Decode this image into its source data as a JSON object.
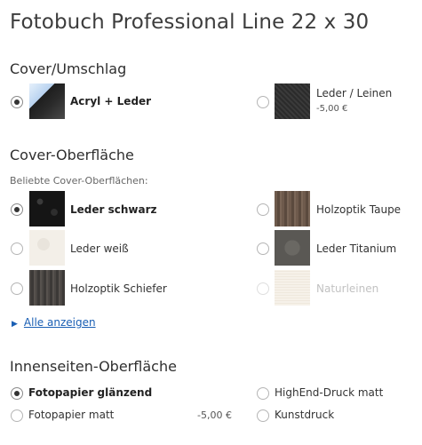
{
  "title": "Fotobuch Professional Line 22 x 30",
  "cover": {
    "heading": "Cover/Umschlag",
    "options": [
      {
        "label": "Acryl + Leder",
        "price": "",
        "selected": true
      },
      {
        "label": "Leder / Leinen",
        "price": "-5,00 €",
        "selected": false
      }
    ]
  },
  "surface": {
    "heading": "Cover-Oberfläche",
    "subheading": "Beliebte Cover-Oberflächen:",
    "options": [
      {
        "label": "Leder schwarz",
        "selected": true
      },
      {
        "label": "Holzoptik Taupe",
        "selected": false
      },
      {
        "label": "Leder weiß",
        "selected": false
      },
      {
        "label": "Leder Titanium",
        "selected": false
      },
      {
        "label": "Holzoptik Schiefer",
        "selected": false
      },
      {
        "label": "Naturleinen",
        "selected": false,
        "disabled": true
      }
    ],
    "show_all": "Alle anzeigen"
  },
  "pages": {
    "heading": "Innenseiten-Oberfläche",
    "options": [
      {
        "label": "Fotopapier glänzend",
        "price": "",
        "selected": true
      },
      {
        "label": "HighEnd-Druck matt",
        "price": "",
        "selected": false
      },
      {
        "label": "Fotopapier matt",
        "price": "-5,00 €",
        "selected": false
      },
      {
        "label": "Kunstdruck",
        "price": "",
        "selected": false
      }
    ]
  },
  "colors": {
    "link": "#1a5fb4",
    "text": "#333333"
  }
}
